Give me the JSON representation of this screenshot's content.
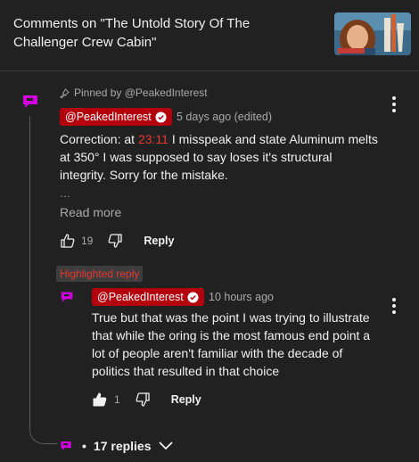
{
  "header": {
    "title": "Comments on \"The Untold Story Of The Challenger Crew Cabin\""
  },
  "pinned_comment": {
    "pinned_label": "Pinned by @PeakedInterest",
    "author": "@PeakedInterest",
    "meta": "5 days ago (edited)",
    "text_before": "Correction: at ",
    "timestamp": "23:11",
    "text_after": " I misspeak and state Aluminum melts at 350° I was supposed to say loses it's structural integrity. Sorry for the mistake.",
    "ellipsis": "…",
    "read_more": "Read more",
    "like_count": "19",
    "reply_label": "Reply"
  },
  "highlighted_reply": {
    "badge": "Highlighted reply",
    "author": "@PeakedInterest",
    "meta": "10 hours ago",
    "text": "True but that was the point I was trying to illustrate that while the oring is the most famous end point a lot of people aren't familiar with the decade of politics that resulted in that choice",
    "like_count": "1",
    "reply_label": "Reply"
  },
  "replies": {
    "bullet": "•",
    "label": "17 replies"
  },
  "colors": {
    "background": "#212121",
    "brand_magenta": "#d000e0",
    "author_chip": "#b3000c",
    "timestamp_red": "#e53935"
  }
}
